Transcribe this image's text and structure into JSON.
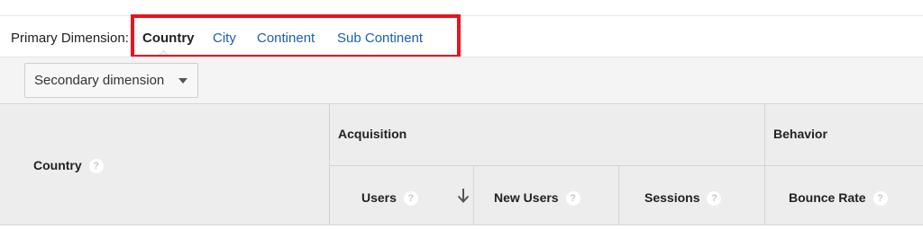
{
  "primary_dimension": {
    "label": "Primary Dimension:",
    "options": [
      {
        "label": "Country",
        "active": true
      },
      {
        "label": "City",
        "active": false
      },
      {
        "label": "Continent",
        "active": false
      },
      {
        "label": "Sub Continent",
        "active": false
      }
    ]
  },
  "secondary_dimension": {
    "label": "Secondary dimension"
  },
  "table": {
    "dimension_header": "Country",
    "groups": [
      {
        "label": "Acquisition"
      },
      {
        "label": "Behavior"
      }
    ],
    "columns": [
      {
        "label": "Users",
        "sorted": "descending"
      },
      {
        "label": "New Users"
      },
      {
        "label": "Sessions"
      },
      {
        "label": "Bounce Rate"
      }
    ],
    "help_glyph": "?"
  },
  "colors": {
    "link": "#1a5fb4",
    "highlight": "#e8141c",
    "header_bg": "#ededed"
  }
}
